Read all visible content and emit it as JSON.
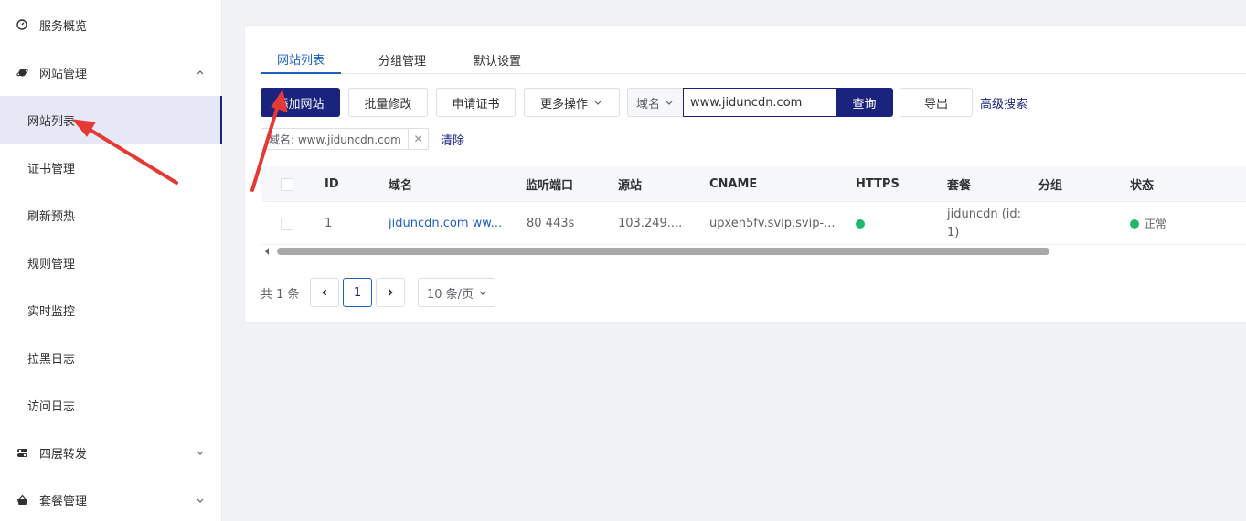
{
  "sidebar": {
    "overview": "服务概览",
    "site_management": "网站管理",
    "items": [
      "网站列表",
      "证书管理",
      "刷新预热",
      "规则管理",
      "实时监控",
      "拉黑日志",
      "访问日志"
    ],
    "layer4": "四层转发",
    "plans": "套餐管理"
  },
  "tabs": [
    "网站列表",
    "分组管理",
    "默认设置"
  ],
  "toolbar": {
    "add_site": "添加网站",
    "batch_edit": "批量修改",
    "apply_cert": "申请证书",
    "more_actions": "更多操作",
    "search_field": "域名",
    "search_value": "www.jiduncdn.com",
    "query": "查询",
    "export": "导出",
    "advanced_search": "高级搜索"
  },
  "filter": {
    "tag": "域名: www.jiduncdn.com",
    "clear": "清除"
  },
  "table": {
    "columns": [
      "ID",
      "域名",
      "监听端口",
      "源站",
      "CNAME",
      "HTTPS",
      "套餐",
      "分组",
      "状态"
    ],
    "rows": [
      {
        "id": "1",
        "domain": "jiduncdn.com ww...",
        "ports": "80 443s",
        "origin": "103.249....",
        "cname": "upxeh5fv.svip.svip-...",
        "plan_line1": "jiduncdn (id:",
        "plan_line2": "1)",
        "group": "",
        "status": "正常"
      }
    ]
  },
  "pagination": {
    "total": "共 1 条",
    "current_page": "1",
    "page_size": "10 条/页"
  },
  "colors": {
    "primary": "#1a237e",
    "link": "#1e60c4",
    "success": "#21b86a",
    "annotation_arrow": "#e53935"
  }
}
